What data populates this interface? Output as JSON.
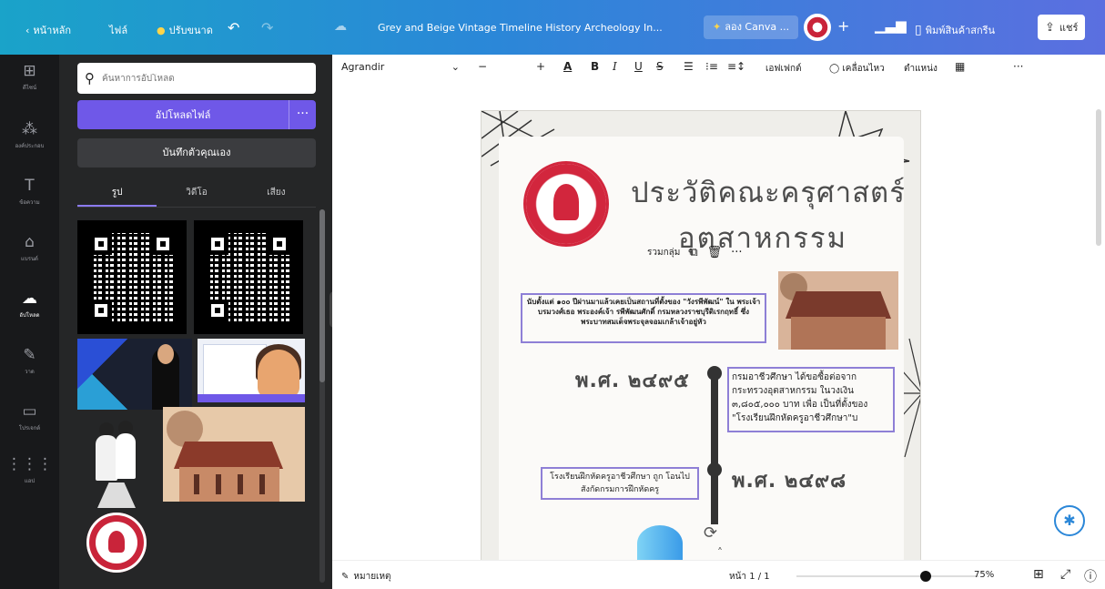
{
  "topbar": {
    "home": "หน้าหลัก",
    "file": "ไฟล์",
    "resize": "ปรับขนาด",
    "title": "Grey and Beige Vintage Timeline History Archeology In...",
    "try_canva": "ลอง Canva ...",
    "print": "พิมพ์สินค้าสกรีน",
    "share": "แชร์"
  },
  "rail": [
    {
      "label": "ดีไซน์",
      "icon": "design-icon"
    },
    {
      "label": "องค์ประกอบ",
      "icon": "elements-icon"
    },
    {
      "label": "ข้อความ",
      "icon": "text-icon"
    },
    {
      "label": "แบรนด์",
      "icon": "brand-icon"
    },
    {
      "label": "อัปโหลด",
      "icon": "upload-icon"
    },
    {
      "label": "วาด",
      "icon": "draw-icon"
    },
    {
      "label": "โปรเจกต์",
      "icon": "projects-icon"
    },
    {
      "label": "แอป",
      "icon": "apps-icon"
    }
  ],
  "panel": {
    "search_placeholder": "ค้นหาการอัปโหลด",
    "upload_button": "อัปโหลดไฟล์",
    "record_button": "บันทึกตัวคุณเอง",
    "tabs": [
      "รูป",
      "วิดีโอ",
      "เสียง"
    ]
  },
  "toolbar": {
    "font": "Agrandir",
    "effects": "เอฟเฟกต์",
    "animate": "เคลื่อนไหว",
    "position": "ตำแหน่ง"
  },
  "canvas": {
    "title_line1": "ประวัติคณะครุศาสตร์",
    "title_line2": "อุตสาหกรรม",
    "group_label": "รวมกลุ่ม",
    "textbox1": "นับตั้งแต่ ๑๐๐ ปีผ่านมาแล้วเคยเป็นสถานที่ตั้งของ \"วังรพีพัฒน์\" ใน พระเจ้าบรมวงศ์เธอ พระองค์เจ้า รพีพัฒนศักดิ์ กรมหลวงราชบุรีดิเรกฤทธิ์ ซึ่งพระบาทสมเด็จพระจุลจอมเกล้าเจ้าอยู่หัว",
    "year1": "พ.ศ. ๒๔๙๕",
    "textbox2": "กรมอาชีวศึกษา ได้ขอซื้อต่อจาก กระทรวงอุตสาหกรรม ในวงเงิน ๓,๘๐๕,๐๐๐ บาท เพื่อ เป็นที่ตั้งของ \"โรงเรียนฝึกหัดครูอาชีวศึกษา\"บ",
    "year2": "พ.ศ. ๒๔๙๘",
    "textbox3": "โรงเรียนฝึกหัดครูอาชีวศึกษา ถูก โอนไปสังกัดกรมการฝึกหัดครู"
  },
  "footer": {
    "notes": "หมายเหตุ",
    "page": "หน้า 1 / 1",
    "zoom": "75%",
    "zoom_level": 0.75
  }
}
